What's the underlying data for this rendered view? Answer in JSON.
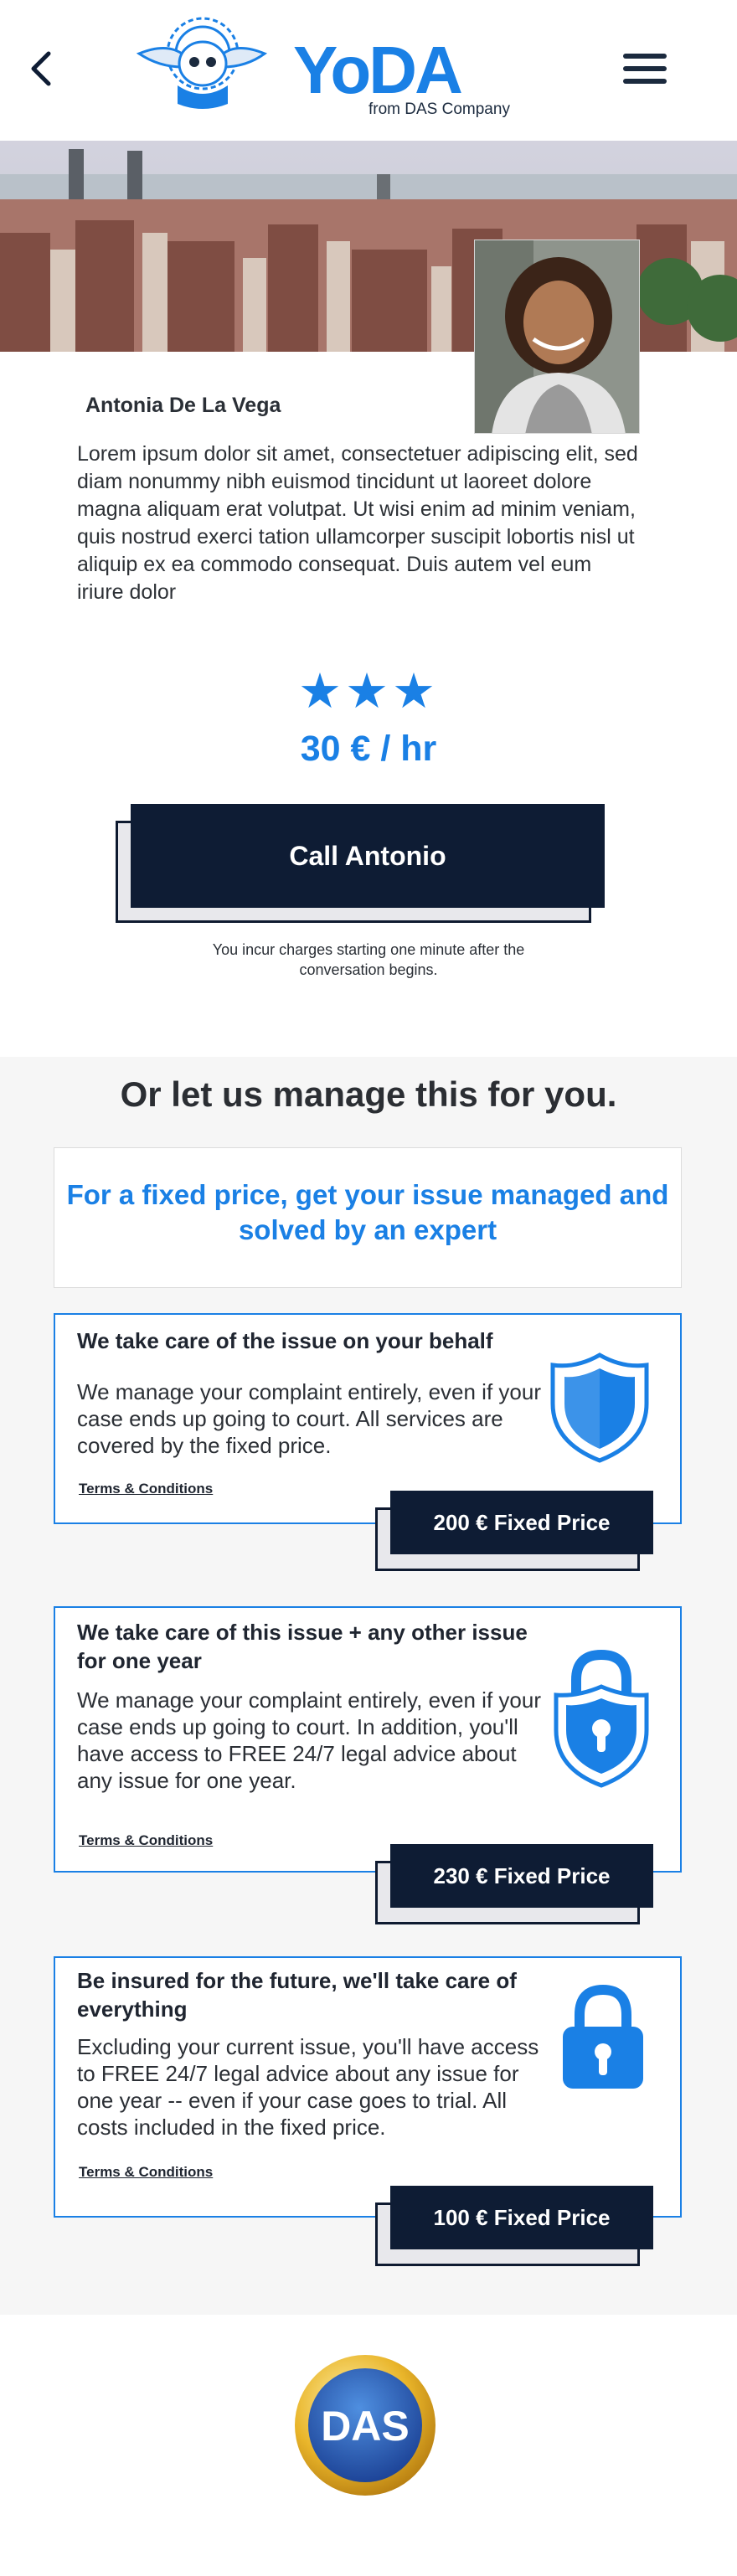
{
  "header": {
    "logo_word": "YoDA",
    "logo_sub": "from DAS Company",
    "back_icon": "chevron-left-icon",
    "menu_icon": "hamburger-menu-icon"
  },
  "profile": {
    "name": "Antonia De La Vega",
    "bio": "Lorem ipsum dolor sit amet, consectetuer adipiscing elit, sed diam nonummy nibh euismod tincidunt ut laoreet dolore magna aliquam erat volutpat. Ut wisi enim ad minim veniam, quis nostrud exerci tation ullamcorper suscipit lobortis nisl ut aliquip ex ea commodo consequat. Duis autem vel eum iriure dolor",
    "rating_stars": 3,
    "stars": "★★★",
    "price": "30 € / hr",
    "call_label": "Call Antonio",
    "charge_note": "You incur charges starting one minute after the conversation begins."
  },
  "managed": {
    "title": "Or let us manage this for you.",
    "promo": "For a fixed price, get your issue managed and solved by an expert",
    "offers": [
      {
        "title": "We take care of the issue on your behalf",
        "description": "We manage your complaint entirely, even if your case ends up going to court. All services are covered by the fixed price.",
        "terms": "Terms & Conditions",
        "price_label": "200 € Fixed Price",
        "icon": "shield-icon"
      },
      {
        "title": "We take care of this issue + any other issue for one year",
        "description": "We manage your complaint entirely, even if your case ends up going to court. In addition, you'll have access to FREE 24/7 legal advice about any issue for one year.",
        "terms": "Terms & Conditions",
        "price_label": "230 € Fixed Price",
        "icon": "shield-lock-icon"
      },
      {
        "title": "Be insured for the future, we'll take care of everything",
        "description": "Excluding your current issue, you'll have access to FREE 24/7 legal advice about any issue for one year -- even if your case goes to trial. All costs included in the fixed price.",
        "terms": "Terms & Conditions",
        "price_label": "100 € Fixed Price",
        "icon": "padlock-icon"
      }
    ]
  },
  "footer": {
    "das_logo_text": "DAS"
  },
  "colors": {
    "brand_blue": "#1a80e5",
    "navy": "#0e1c34",
    "section_bg": "#f6f6f6"
  }
}
